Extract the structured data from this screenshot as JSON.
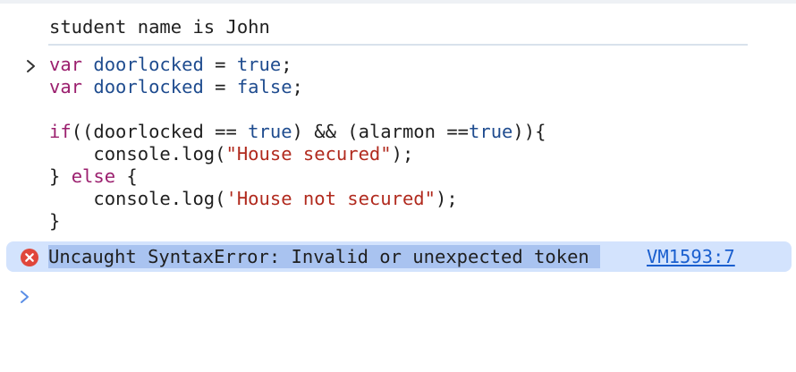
{
  "console": {
    "log_output": "student name is John",
    "input_code": [
      [
        {
          "t": "var",
          "c": "kw"
        },
        {
          "t": " ",
          "c": "plain"
        },
        {
          "t": "doorlocked",
          "c": "var"
        },
        {
          "t": " = ",
          "c": "plain"
        },
        {
          "t": "true",
          "c": "bool"
        },
        {
          "t": ";",
          "c": "plain"
        }
      ],
      [
        {
          "t": "var",
          "c": "kw"
        },
        {
          "t": " ",
          "c": "plain"
        },
        {
          "t": "doorlocked",
          "c": "var"
        },
        {
          "t": " = ",
          "c": "plain"
        },
        {
          "t": "false",
          "c": "bool"
        },
        {
          "t": ";",
          "c": "plain"
        }
      ],
      [],
      [
        {
          "t": "if",
          "c": "kw"
        },
        {
          "t": "((doorlocked == ",
          "c": "plain"
        },
        {
          "t": "true",
          "c": "bool"
        },
        {
          "t": ") && (alarmon ==",
          "c": "plain"
        },
        {
          "t": "true",
          "c": "bool"
        },
        {
          "t": ")){",
          "c": "plain"
        }
      ],
      [
        {
          "t": "    console.log(",
          "c": "plain"
        },
        {
          "t": "\"House secured\"",
          "c": "str"
        },
        {
          "t": ");",
          "c": "plain"
        }
      ],
      [
        {
          "t": "} ",
          "c": "plain"
        },
        {
          "t": "else",
          "c": "kw"
        },
        {
          "t": " {",
          "c": "plain"
        }
      ],
      [
        {
          "t": "    console.log(",
          "c": "plain"
        },
        {
          "t": "'House not secured\"",
          "c": "str"
        },
        {
          "t": ");",
          "c": "plain"
        }
      ],
      [
        {
          "t": "}",
          "c": "plain"
        }
      ]
    ],
    "error": {
      "message": "Uncaught SyntaxError: Invalid or unexpected token",
      "source_link": "VM1593:7"
    },
    "icons": {
      "input_prompt": "chevron-right-icon",
      "error": "error-circle-icon",
      "new_prompt": "chevron-right-icon"
    },
    "colors": {
      "keyword": "#9b1f6e",
      "identifier": "#1f4c8f",
      "string": "#b12a1e",
      "error_bg": "#d3e3fd",
      "error_icon": "#e0463a",
      "link": "#1a5fcf",
      "prompt": "#5a8ee6"
    }
  }
}
